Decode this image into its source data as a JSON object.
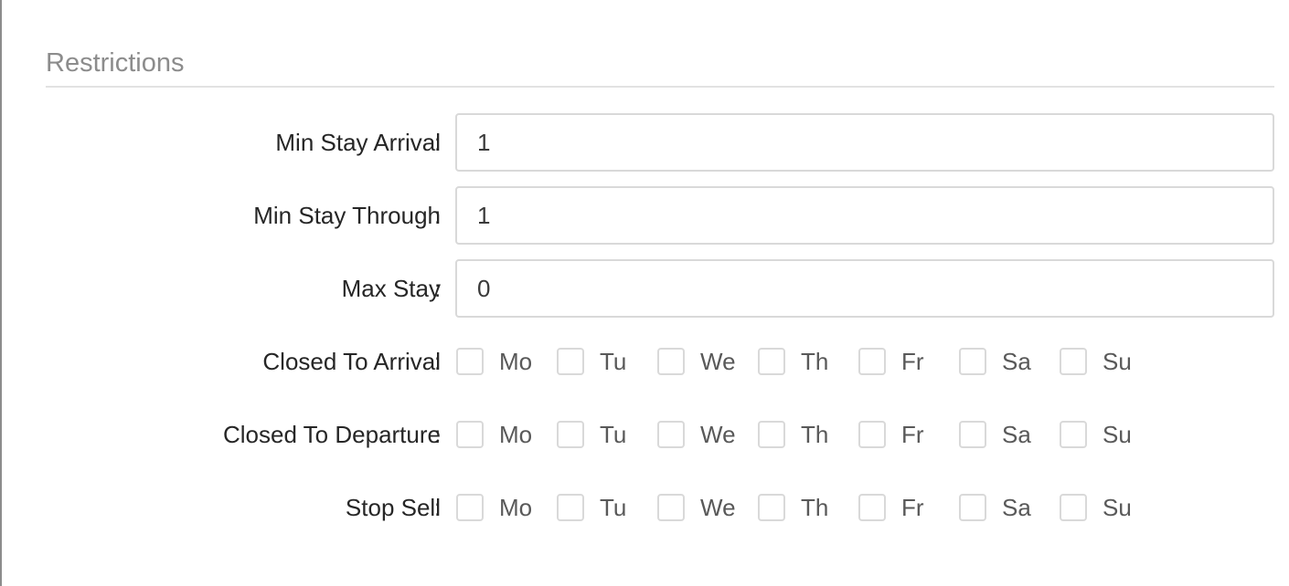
{
  "section": {
    "title": "Restrictions"
  },
  "fields": [
    {
      "label": "Min Stay Arrival",
      "value": "1"
    },
    {
      "label": "Min Stay Through",
      "value": "1"
    },
    {
      "label": "Max Stay",
      "value": "0"
    }
  ],
  "colon": ":",
  "day_rows": [
    {
      "label": "Closed To Arrival",
      "days": [
        {
          "label": "Mo",
          "checked": false
        },
        {
          "label": "Tu",
          "checked": false
        },
        {
          "label": "We",
          "checked": false
        },
        {
          "label": "Th",
          "checked": false
        },
        {
          "label": "Fr",
          "checked": false
        },
        {
          "label": "Sa",
          "checked": false
        },
        {
          "label": "Su",
          "checked": false
        }
      ]
    },
    {
      "label": "Closed To Departure",
      "days": [
        {
          "label": "Mo",
          "checked": false
        },
        {
          "label": "Tu",
          "checked": false
        },
        {
          "label": "We",
          "checked": false
        },
        {
          "label": "Th",
          "checked": false
        },
        {
          "label": "Fr",
          "checked": false
        },
        {
          "label": "Sa",
          "checked": false
        },
        {
          "label": "Su",
          "checked": false
        }
      ]
    },
    {
      "label": "Stop Sell",
      "days": [
        {
          "label": "Mo",
          "checked": false
        },
        {
          "label": "Tu",
          "checked": false
        },
        {
          "label": "We",
          "checked": false
        },
        {
          "label": "Th",
          "checked": false
        },
        {
          "label": "Fr",
          "checked": false
        },
        {
          "label": "Sa",
          "checked": false
        },
        {
          "label": "Su",
          "checked": false
        }
      ]
    }
  ]
}
